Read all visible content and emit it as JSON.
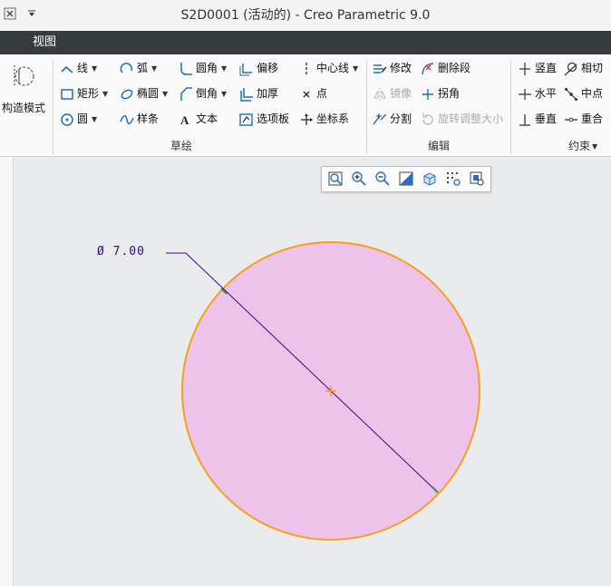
{
  "window": {
    "title": "S2D0001 (活动的) - Creo Parametric 9.0"
  },
  "quick_access": {
    "icons": [
      "close-window-icon",
      "customize-arrow-icon"
    ]
  },
  "menu": {
    "view": "视图"
  },
  "ribbon": {
    "construction_mode": "构造模式",
    "sketch_group": {
      "label": "草绘",
      "line": "线",
      "arc": "弧",
      "fillet": "圆角",
      "offset": "偏移",
      "centerline": "中心线",
      "rectangle": "矩形",
      "ellipse": "椭圆",
      "chamfer": "倒角",
      "thicken": "加厚",
      "point": "点",
      "circle": "圆",
      "spline": "样条",
      "text": "文本",
      "palette": "选项板",
      "coordsys": "坐标系"
    },
    "edit_group": {
      "label": "编辑",
      "modify": "修改",
      "delete_segment": "删除段",
      "mirror": "镜像",
      "corner": "拐角",
      "divide": "分割",
      "rotate_resize": "旋转调整大小"
    },
    "constrain_group": {
      "label": "约束",
      "vertical": "竖直",
      "tangent": "相切",
      "horizontal": "水平",
      "midpoint": "中点",
      "perpendicular": "垂直",
      "coincident": "重合"
    }
  },
  "view_toolbar": {
    "icons": [
      "refit-icon",
      "zoom-in-icon",
      "zoom-out-icon",
      "repaint-icon",
      "shading-icon",
      "sketcher-display-icon",
      "saved-orientations-icon"
    ]
  },
  "sketch": {
    "dimension_label": "Ø 7.00",
    "colors": {
      "fill": "#eec3ea",
      "outline": "#f4a11f",
      "dimension": "#3a0a78",
      "center": "#f39a18"
    }
  }
}
